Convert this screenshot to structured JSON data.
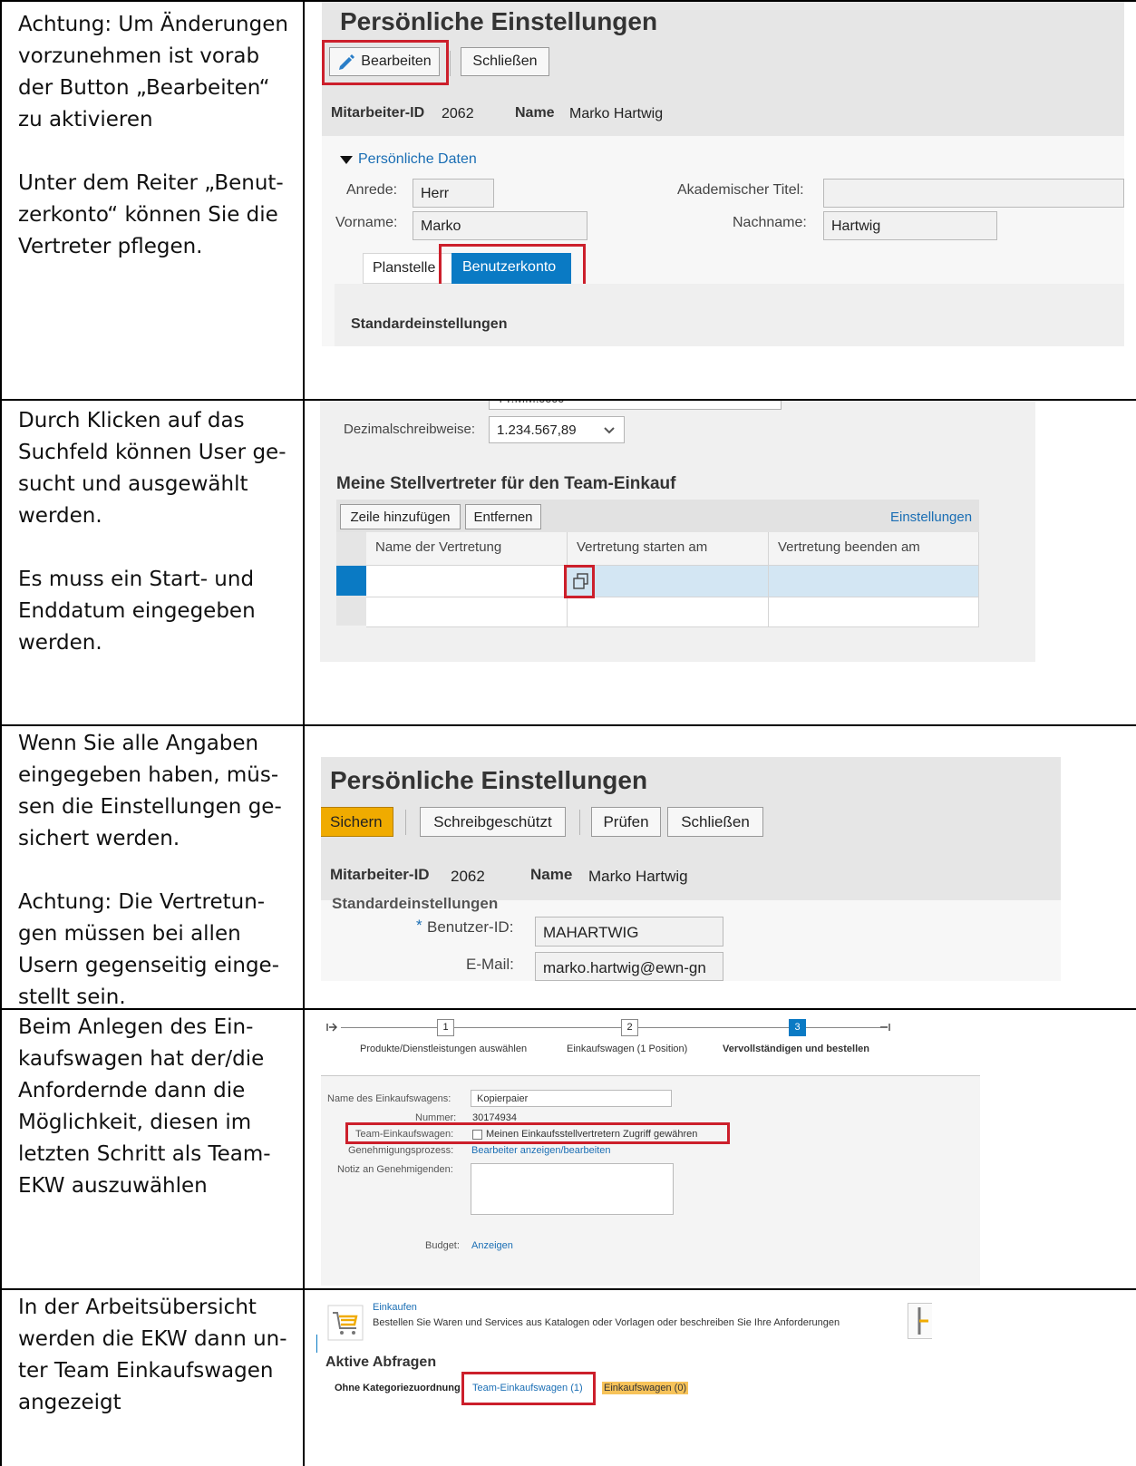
{
  "rows": [
    {
      "instruction": [
        "Achtung: Um Änderungen vorzunehmen ist vorab der Button „Bearbeiten“ zu aktivieren",
        "Unter dem Reiter „Benut-zerkonto“ können Sie die Vertreter pflegen."
      ]
    },
    {
      "instruction": [
        "Durch Klicken auf das Suchfeld können User ge-sucht und ausgewählt werden.",
        "Es muss ein Start- und Enddatum eingegeben werden."
      ]
    },
    {
      "instruction": [
        "Wenn Sie alle Angaben eingegeben haben, müs-sen die Einstellungen ge-sichert werden.",
        "Achtung: Die Vertretun-gen müssen bei allen Usern gegenseitig einge-stellt sein."
      ]
    },
    {
      "instruction": [
        "Beim Anlegen des Ein-kaufswagen hat der/die Anfordernde dann die Möglichkeit, diesen im letzten Schritt als Team-EKW auszuwählen"
      ]
    },
    {
      "instruction": [
        "In der Arbeitsübersicht werden die EKW dann un-ter Team Einkaufswagen angezeigt"
      ]
    }
  ],
  "shot1": {
    "title": "Persönliche Einstellungen",
    "edit_button": "Bearbeiten",
    "close_button": "Schließen",
    "employee_id_label": "Mitarbeiter-ID",
    "employee_id": "2062",
    "name_label": "Name",
    "name": "Marko Hartwig",
    "section": "Persönliche Daten",
    "salutation_label": "Anrede:",
    "salutation": "Herr",
    "academic_title_label": "Akademischer Titel:",
    "academic_title": "",
    "first_name_label": "Vorname:",
    "first_name": "Marko",
    "last_name_label": "Nachname:",
    "last_name": "Hartwig",
    "tab_position": "Planstelle",
    "tab_account": "Benutzerkonto",
    "standard_settings": "Standardeinstellungen"
  },
  "shot2": {
    "date_format_partial": "TT.MM.JJJJ",
    "decimal_label": "Dezimalschreibweise:",
    "decimal_value": "1.234.567,89",
    "heading": "Meine Stellvertreter für den Team-Einkauf",
    "add_row_button": "Zeile hinzufügen",
    "remove_button": "Entfernen",
    "settings_link": "Einstellungen",
    "columns": [
      "Name der Vertretung",
      "Vertretung starten am",
      "Vertretung beenden am"
    ]
  },
  "shot3": {
    "title": "Persönliche Einstellungen",
    "save_button": "Sichern",
    "readonly_button": "Schreibgeschützt",
    "check_button": "Prüfen",
    "close_button": "Schließen",
    "employee_id_label": "Mitarbeiter-ID",
    "employee_id": "2062",
    "name_label": "Name",
    "name": "Marko Hartwig",
    "standard_settings_partial": "Standardeinstellungen",
    "required_mark": "*",
    "user_id_label": "Benutzer-ID:",
    "user_id": "MAHARTWIG",
    "email_label": "E-Mail:",
    "email": "marko.hartwig@ewn-gn"
  },
  "shot4": {
    "steps": [
      {
        "number": "1",
        "label": "Produkte/Dienstleistungen auswählen"
      },
      {
        "number": "2",
        "label": "Einkaufswagen (1 Position)"
      },
      {
        "number": "3",
        "label": "Vervollständigen und bestellen"
      }
    ],
    "cart_name_label": "Name des Einkaufswagens:",
    "cart_name": "Kopierpaier",
    "number_label": "Nummer:",
    "number": "30174934",
    "team_cart_label": "Team-Einkaufswagen:",
    "team_cart_checkbox": "Meinen Einkaufsstellvertretern Zugriff gewähren",
    "approval_label": "Genehmigungsprozess:",
    "approval_link": "Bearbeiter anzeigen/bearbeiten",
    "note_label": "Notiz an Genehmigenden:",
    "budget_label": "Budget:",
    "budget_link": "Anzeigen"
  },
  "shot5": {
    "shop_title": "Einkaufen",
    "shop_desc": "Bestellen Sie Waren und Services aus Katalogen oder Vorlagen oder beschreiben Sie Ihre Anforderungen",
    "active_queries": "Aktive Abfragen",
    "no_category": "Ohne Kategoriezuordnung",
    "team_carts_link": "Team-Einkaufswagen (1)",
    "carts_link": "Einkaufswagen (0)"
  },
  "colors": {
    "sap_blue": "#0a7ac4",
    "sap_link": "#1a6eb4",
    "highlight_red": "#cc1f2b",
    "save_yellow": "#f0ab00",
    "selected_row": "#d3e6f3"
  }
}
